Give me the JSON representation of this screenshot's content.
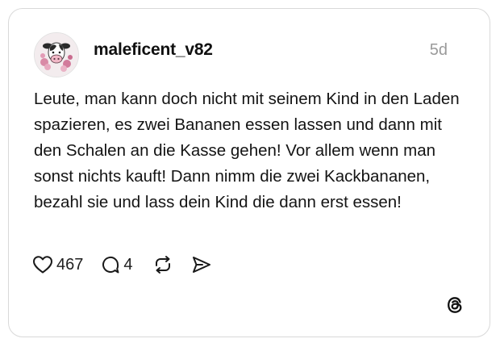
{
  "post": {
    "author": {
      "username": "maleficent_v82",
      "avatar_icon": "cow-avatar-icon"
    },
    "timestamp": "5d",
    "text": "Leute, man kann doch nicht mit seinem Kind in den Laden spazieren, es zwei Bananen essen lassen und dann mit den Schalen an die Kasse gehen! Vor allem wenn man sonst nichts kauft! Dann nimm die zwei Kackbananen, bezahl sie und lass dein Kind die dann erst essen!",
    "actions": {
      "like_count": "467",
      "reply_count": "4",
      "like_icon": "heart-icon",
      "reply_icon": "comment-bubble-icon",
      "repost_icon": "repost-icon",
      "share_icon": "send-icon"
    },
    "brand_icon": "threads-logo-icon"
  },
  "colors": {
    "text": "#101010",
    "muted": "#9a9a9a",
    "border": "#d9d9d9",
    "background": "#ffffff"
  }
}
